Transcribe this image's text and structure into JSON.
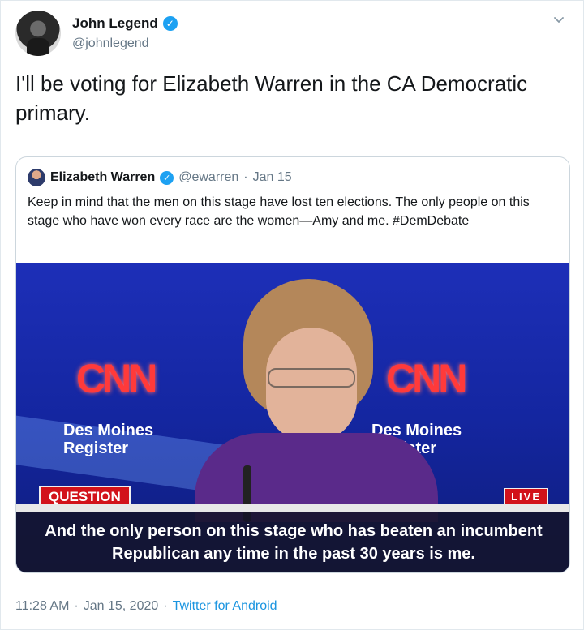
{
  "author": {
    "name": "John Legend",
    "handle": "@johnlegend",
    "verified_mark": "✓",
    "avatar_icon": "avatar"
  },
  "tweet": {
    "text": "I'll be voting for Elizabeth Warren in the CA Democratic primary."
  },
  "quoted": {
    "name": "Elizabeth Warren",
    "verified_mark": "✓",
    "handle": "@ewarren",
    "separator": "·",
    "date": "Jan 15",
    "text": "Keep in mind that the men on this stage have lost ten elections. The only people on this stage who have won every race are the women—Amy and me. #DemDebate",
    "video": {
      "logo_left": "CNN",
      "logo_right": "CNN",
      "sponsor_left": "Des Moines\nRegister",
      "sponsor_right": "Des Moines\nRegister",
      "lower_third_tag": "QUESTION",
      "live_tag": "LIVE",
      "caption": "And the only person on this stage who has beaten an incumbent Republican any time in the past 30 years is me."
    }
  },
  "meta": {
    "time": "11:28 AM",
    "separator": "·",
    "date": "Jan 15, 2020",
    "separator2": "·",
    "source": "Twitter for Android"
  },
  "colors": {
    "link": "#1b95e0",
    "verified": "#1da1f2",
    "muted": "#657786",
    "cnn_red": "#ff3a3a"
  }
}
